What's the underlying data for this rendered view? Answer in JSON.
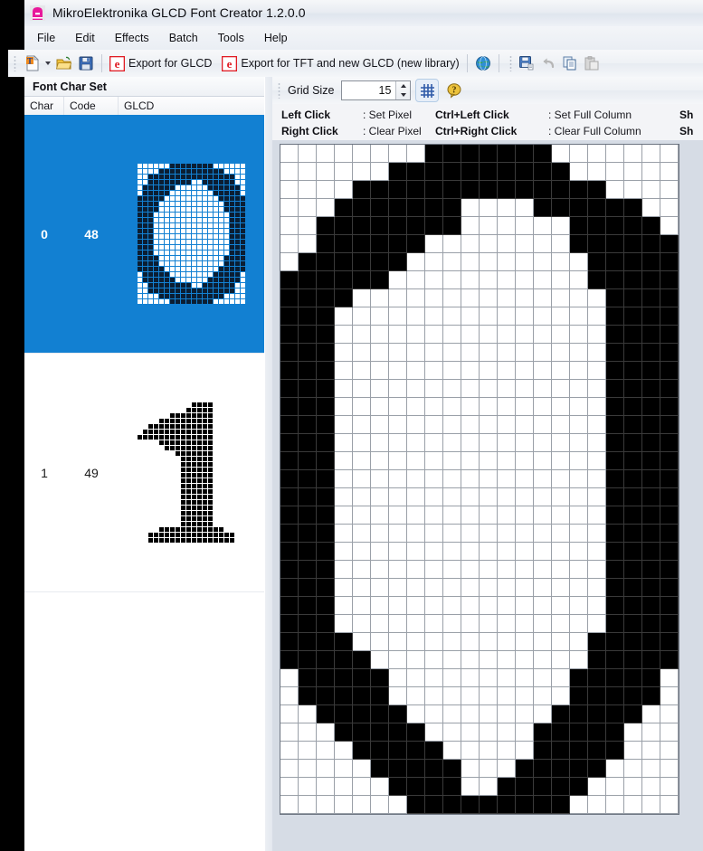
{
  "window": {
    "title": "MikroElektronika GLCD Font Creator 1.2.0.0",
    "logo_icon": "app-logo-icon"
  },
  "menu": {
    "items": [
      {
        "label": "File"
      },
      {
        "label": "Edit"
      },
      {
        "label": "Effects"
      },
      {
        "label": "Batch"
      },
      {
        "label": "Tools"
      },
      {
        "label": "Help"
      }
    ]
  },
  "toolbar": {
    "items": [
      {
        "name": "new-font-button",
        "icon": "new-font-icon",
        "label": "",
        "has_caret": true
      },
      {
        "name": "open-button",
        "icon": "open-folder-icon",
        "label": ""
      },
      {
        "name": "save-button",
        "icon": "save-disk-icon",
        "label": ""
      },
      {
        "name": "export-glcd-button",
        "icon": "export-glcd-icon",
        "label": "Export for GLCD"
      },
      {
        "name": "export-tft-button",
        "icon": "export-tft-icon",
        "label": "Export for TFT and new GLCD (new library)"
      },
      {
        "name": "web-button",
        "icon": "globe-icon",
        "label": ""
      },
      {
        "name": "save-as-button",
        "icon": "save-as-icon",
        "label": ""
      },
      {
        "name": "undo-button",
        "icon": "undo-icon",
        "label": ""
      },
      {
        "name": "copy-button",
        "icon": "copy-icon",
        "label": ""
      },
      {
        "name": "paste-button",
        "icon": "paste-icon",
        "label": ""
      }
    ]
  },
  "char_set_panel": {
    "title": "Font Char Set",
    "columns": [
      "Char",
      "Code",
      "GLCD"
    ],
    "rows": [
      {
        "char": "0",
        "code": "48",
        "selected": true,
        "preview": [
          "00000011111111000000",
          "00001111111111110000",
          "00111111111111111100",
          "00111111110011111100",
          "01111110000001111110",
          "01111100000000111110",
          "11111000000000011111",
          "11110000000000001111",
          "11110000000000001111",
          "11100000000000000111",
          "11100000000000000111",
          "11100000000000000111",
          "11100000000000000111",
          "11100000000000000111",
          "11100000000000000111",
          "11100000000000000111",
          "11100000000000000111",
          "11110000000000001111",
          "11110000000000001111",
          "11111000000000011111",
          "01111100000000111110",
          "01111110000001111110",
          "00111111110011111100",
          "00111111111111111100",
          "00001111111111110000",
          "00000011111111000000"
        ]
      },
      {
        "char": "1",
        "code": "49",
        "selected": false,
        "preview": [
          "00000000001111000000",
          "00000000011111000000",
          "00000011111111000000",
          "00001111111111000000",
          "00111111111111000000",
          "01111111111111000000",
          "11111111111111000000",
          "00001111111111000000",
          "00000111111111000000",
          "00000001111111000000",
          "00000000111111000000",
          "00000000111111000000",
          "00000000111111000000",
          "00000000111111000000",
          "00000000111111000000",
          "00000000111111000000",
          "00000000111111000000",
          "00000000111111000000",
          "00000000111111000000",
          "00000000111111000000",
          "00000000111111000000",
          "00000000111111000000",
          "00000000111111000000",
          "00001111111111110000",
          "00111111111111111100",
          "00111111111111111100"
        ]
      }
    ]
  },
  "grid_toolbar": {
    "grid_size_label": "Grid Size",
    "grid_size_value": "15",
    "toggle_grid_icon": "grid-toggle-icon",
    "help_icon": "help-balloon-icon"
  },
  "hints": {
    "rows": [
      [
        {
          "key": "Left Click",
          "value": ": Set Pixel"
        },
        {
          "key": "Ctrl+Left Click",
          "value": ": Set Full Column"
        },
        {
          "key": "Sh",
          "value": ""
        }
      ],
      [
        {
          "key": "Right Click",
          "value": ": Clear Pixel"
        },
        {
          "key": "Ctrl+Right Click",
          "value": ": Clear Full Column"
        },
        {
          "key": "Sh",
          "value": ""
        }
      ]
    ]
  },
  "editor": {
    "columns": 22,
    "rows": 37,
    "cell_size": 20,
    "on_color": "#000000",
    "off_color": "#ffffff",
    "grid_line_color": "#9aa0a8",
    "pixels": [
      "0000000011111110000000",
      "0000001111111111000000",
      "0000111111111111110000",
      "0001111111000011111100",
      "0011111111000000111110",
      "0011111100000000111111",
      "0111111000000000011111",
      "1111110000000000011111",
      "1111000000000000001111",
      "1110000000000000001111",
      "1110000000000000001111",
      "1110000000000000001111",
      "1110000000000000001111",
      "1110000000000000001111",
      "1110000000000000001111",
      "1110000000000000001111",
      "1110000000000000001111",
      "1110000000000000001111",
      "1110000000000000001111",
      "1110000000000000001111",
      "1110000000000000001111",
      "1110000000000000001111",
      "1110000000000000001111",
      "1110000000000000001111",
      "1110000000000000001111",
      "1110000000000000001111",
      "1110000000000000001111",
      "1111000000000000011111",
      "1111100000000000011111",
      "0111110000000000111110",
      "0111110000000000111110",
      "0011111000000001111100",
      "0001111100000011111000",
      "0000111110000011111000",
      "0000011111000111110000",
      "0000001111001111100000",
      "0000000111111111000000"
    ]
  }
}
